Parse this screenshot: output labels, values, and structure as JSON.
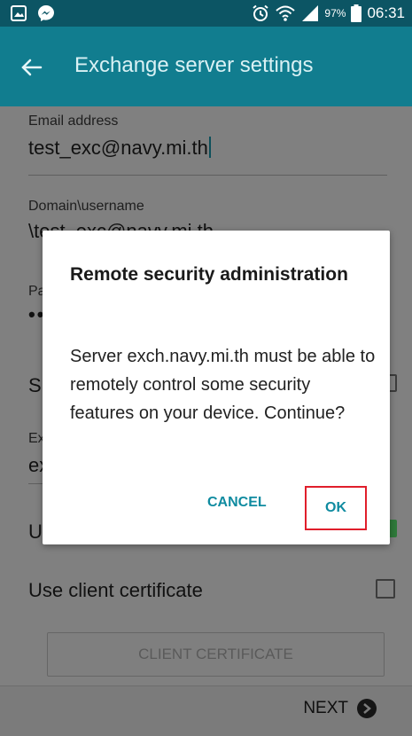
{
  "status_bar": {
    "left_icons": [
      "gallery-icon",
      "messenger-icon"
    ],
    "right_icons": [
      "alarm-icon",
      "wifi-icon",
      "signal-icon",
      "battery-icon"
    ],
    "battery": "97%",
    "time": "06:31",
    "color": "#0c5564"
  },
  "app_bar": {
    "title": "Exchange server settings",
    "back_icon": "back-arrow-icon",
    "color": "#117d8f"
  },
  "form": {
    "email_label": "Email address",
    "email_value": "test_exc@navy.mi.th",
    "domain_label": "Domain\\username",
    "domain_value": "\\test_exc@navy.mi.th",
    "password_label_visible": "Pa",
    "password_value": "••",
    "show_label_visible": "Sl",
    "exchange_label_visible": "Ex",
    "exchange_value_visible": "ex",
    "use_ssl_visible": "U",
    "use_ssl_checked": true,
    "client_cert_label": "Use client certificate",
    "client_cert_checked": false,
    "client_cert_button": "CLIENT CERTIFICATE"
  },
  "bottom_bar": {
    "next_label": "NEXT",
    "next_icon": "arrow-right-circle-icon"
  },
  "dialog": {
    "title": "Remote security administration",
    "message": "Server exch.navy.mi.th must be able to remotely control some security features on your device. Continue?",
    "cancel_label": "CANCEL",
    "ok_label": "OK",
    "accent": "#0f8ba0",
    "highlight": "#e01e2b"
  }
}
